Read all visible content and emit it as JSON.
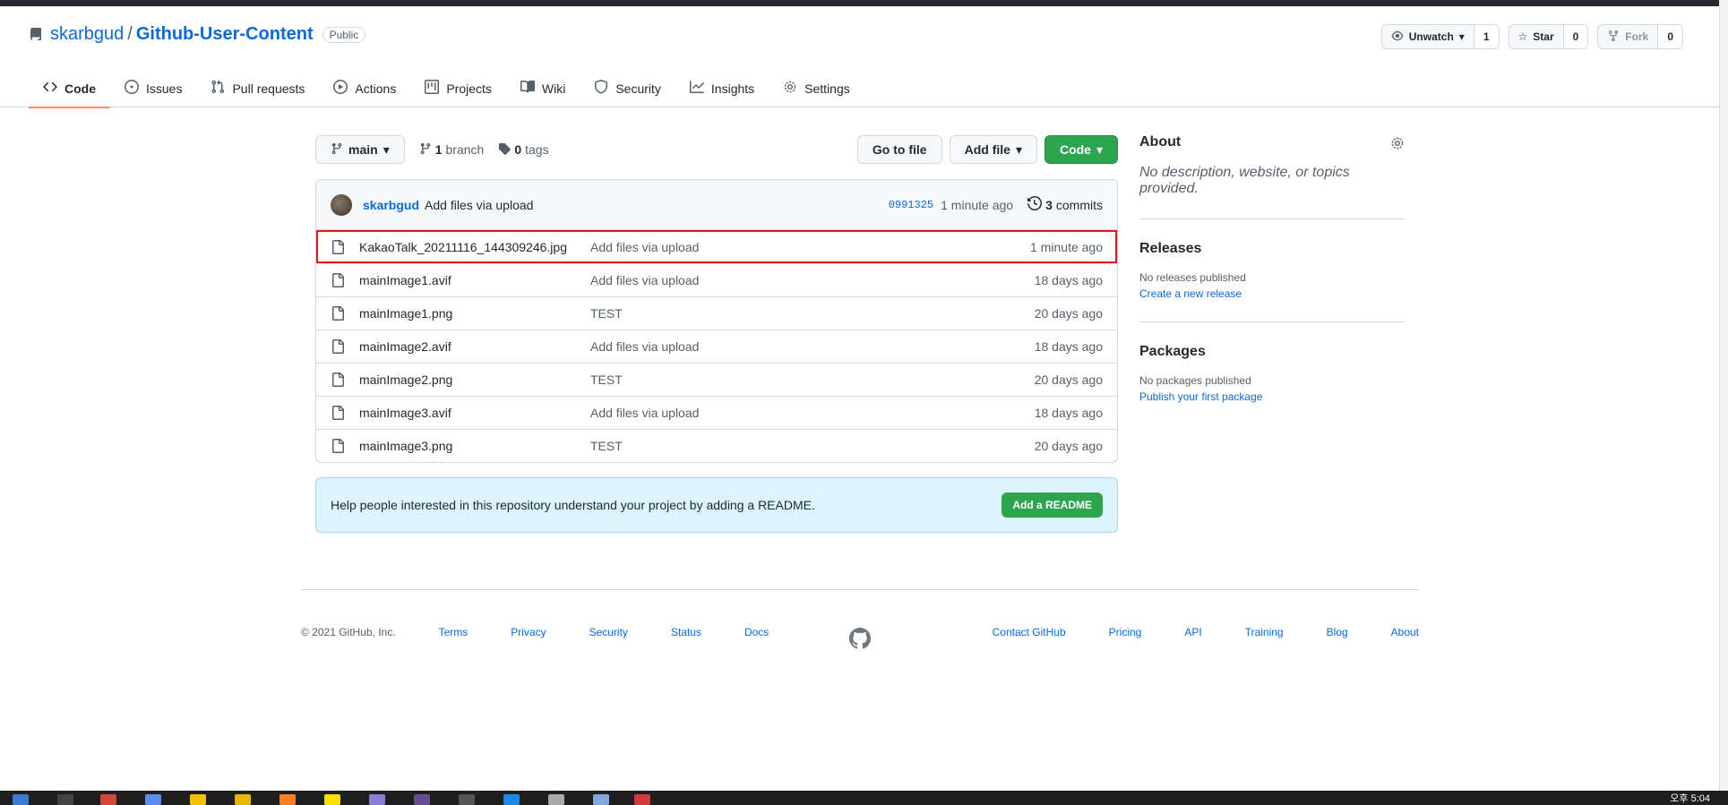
{
  "repo": {
    "owner": "skarbgud",
    "separator": "/",
    "name": "Github-User-Content",
    "visibility": "Public"
  },
  "actions": {
    "watch": {
      "label": "Unwatch",
      "count": "1"
    },
    "star": {
      "label": "Star",
      "count": "0"
    },
    "fork": {
      "label": "Fork",
      "count": "0"
    }
  },
  "tabs": [
    {
      "label": "Code",
      "icon": "code-icon"
    },
    {
      "label": "Issues",
      "icon": "issue-icon"
    },
    {
      "label": "Pull requests",
      "icon": "pull-request-icon"
    },
    {
      "label": "Actions",
      "icon": "play-icon"
    },
    {
      "label": "Projects",
      "icon": "project-icon"
    },
    {
      "label": "Wiki",
      "icon": "book-icon"
    },
    {
      "label": "Security",
      "icon": "shield-icon"
    },
    {
      "label": "Insights",
      "icon": "graph-icon"
    },
    {
      "label": "Settings",
      "icon": "gear-icon"
    }
  ],
  "file_nav": {
    "branch": "main",
    "branch_count": "1",
    "branch_label": "branch",
    "tag_count": "0",
    "tag_label": "tags",
    "go_to_file": "Go to file",
    "add_file": "Add file",
    "code": "Code"
  },
  "latest_commit": {
    "author": "skarbgud",
    "message": "Add files via upload",
    "sha": "0991325",
    "age": "1 minute ago",
    "commit_count": "3",
    "commit_label": "commits"
  },
  "files": [
    {
      "name": "KakaoTalk_20211116_144309246.jpg",
      "commit": "Add files via upload",
      "age": "1 minute ago"
    },
    {
      "name": "mainImage1.avif",
      "commit": "Add files via upload",
      "age": "18 days ago"
    },
    {
      "name": "mainImage1.png",
      "commit": "TEST",
      "age": "20 days ago"
    },
    {
      "name": "mainImage2.avif",
      "commit": "Add files via upload",
      "age": "18 days ago"
    },
    {
      "name": "mainImage2.png",
      "commit": "TEST",
      "age": "20 days ago"
    },
    {
      "name": "mainImage3.avif",
      "commit": "Add files via upload",
      "age": "18 days ago"
    },
    {
      "name": "mainImage3.png",
      "commit": "TEST",
      "age": "20 days ago"
    }
  ],
  "readme": {
    "text": "Help people interested in this repository understand your project by adding a README.",
    "button": "Add a README"
  },
  "sidebar": {
    "about_title": "About",
    "about_desc": "No description, website, or topics provided.",
    "releases_title": "Releases",
    "releases_none": "No releases published",
    "releases_link": "Create a new release",
    "packages_title": "Packages",
    "packages_none": "No packages published",
    "packages_link": "Publish your first package"
  },
  "footer": {
    "copyright": "© 2021 GitHub, Inc.",
    "left_links": [
      "Terms",
      "Privacy",
      "Security",
      "Status",
      "Docs"
    ],
    "right_links": [
      "Contact GitHub",
      "Pricing",
      "API",
      "Training",
      "Blog",
      "About"
    ]
  },
  "taskbar": {
    "clock": "오후 5:04"
  },
  "colors": {
    "accent": "#0969da",
    "primary_button": "#2da44e",
    "highlight_outline": "#e01b1b",
    "active_tab_underline": "#fd8c73"
  }
}
